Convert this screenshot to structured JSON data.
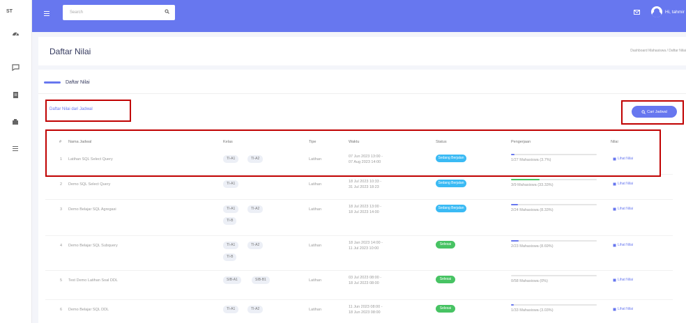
{
  "sidebar": {
    "logo": "ST",
    "icons": [
      "dashboard-icon",
      "chat-icon",
      "book-icon",
      "document-icon",
      "menu-icon"
    ]
  },
  "topbar": {
    "search_placeholder": "Search",
    "user_name": "Hi, tahmir"
  },
  "header": {
    "title": "Daftar Nilai",
    "breadcrumb": "Dashboard Mahasiswa / Daftar Nilai"
  },
  "card": {
    "title": "Daftar Nilai",
    "subtitle": "Daftar Nilai dari Jadwal",
    "search_button": "Cari Jadwal"
  },
  "table": {
    "headers": [
      "#",
      "Nama Jadwal",
      "Kelas",
      "Tipe",
      "Waktu",
      "Status",
      "Pengerjaan",
      "Nilai"
    ],
    "rows": [
      {
        "no": "1",
        "nama": "Latihan SQL Select Query",
        "kelas": [
          "TI-A1",
          "TI-A2"
        ],
        "tipe": "Latihan",
        "waktu": [
          "07 Jun 2023 13:00 -",
          "07 Aug 2023 14:00"
        ],
        "status": "Sedang Berjalan",
        "status_color": "#3abaf4",
        "progress_text": "1/27 Mahasiswa (3.7%)",
        "progress": 0.037,
        "progress_color": "#6777ef",
        "nilai": "Lihat Nilai"
      },
      {
        "no": "2",
        "nama": "Demo SQL Select Query",
        "kelas": [
          "TI-A1"
        ],
        "tipe": "Latihan",
        "waktu": [
          "18 Jul 2023 10:33 -",
          "31 Jul 2023 18:23"
        ],
        "status": "Sedang Berjalan",
        "status_color": "#3abaf4",
        "progress_text": "3/9 Mahasiswa (33.33%)",
        "progress": 0.3333,
        "progress_color": "#47c363",
        "nilai": "Lihat Nilai"
      },
      {
        "no": "3",
        "nama": "Demo Belajar SQL Agregasi",
        "kelas": [
          "TI-A1",
          "TI-A2",
          "TI-B"
        ],
        "tipe": "Latihan",
        "waktu": [
          "18 Jul 2023 13:00 -",
          "18 Jul 2023 14:00"
        ],
        "status": "Sedang Berjalan",
        "status_color": "#3abaf4",
        "progress_text": "2/24 Mahasiswa (8.33%)",
        "progress": 0.0833,
        "progress_color": "#6777ef",
        "nilai": "Lihat Nilai"
      },
      {
        "no": "4",
        "nama": "Demo Belajar SQL Subquery",
        "kelas": [
          "TI-A1",
          "TI-A2",
          "TI-B"
        ],
        "tipe": "Latihan",
        "waktu": [
          "18 Jan 2023 14:00 -",
          "11 Jul 2023 10:00"
        ],
        "status": "Selesai",
        "status_color": "#47c363",
        "progress_text": "2/23 Mahasiswa (8.69%)",
        "progress": 0.0869,
        "progress_color": "#6777ef",
        "nilai": "Lihat Nilai"
      },
      {
        "no": "5",
        "nama": "Test Demo Latihan Soal DDL",
        "kelas": [
          "SIB-A1",
          "SIB-B1"
        ],
        "tipe": "Latihan",
        "waktu": [
          "03 Jul 2023 08:00 -",
          "18 Jul 2023 08:00"
        ],
        "status": "Selesai",
        "status_color": "#47c363",
        "progress_text": "0/58 Mahasiswa (0%)",
        "progress": 0,
        "progress_color": "#6777ef",
        "nilai": "Lihat Nilai"
      },
      {
        "no": "6",
        "nama": "Demo Belajar SQL DDL",
        "kelas": [
          "TI-A1",
          "TI-A2"
        ],
        "tipe": "Latihan",
        "waktu": [
          "11 Jun 2023 08:00 -",
          "18 Jun 2023 08:00"
        ],
        "status": "Selesai",
        "status_color": "#47c363",
        "progress_text": "1/33 Mahasiswa (3.03%)",
        "progress": 0.0303,
        "progress_color": "#6777ef",
        "nilai": "Lihat Nilai"
      }
    ]
  },
  "colors": {
    "primary": "#6777ef",
    "info": "#3abaf4",
    "success": "#47c363",
    "highlight": "#c00000"
  }
}
